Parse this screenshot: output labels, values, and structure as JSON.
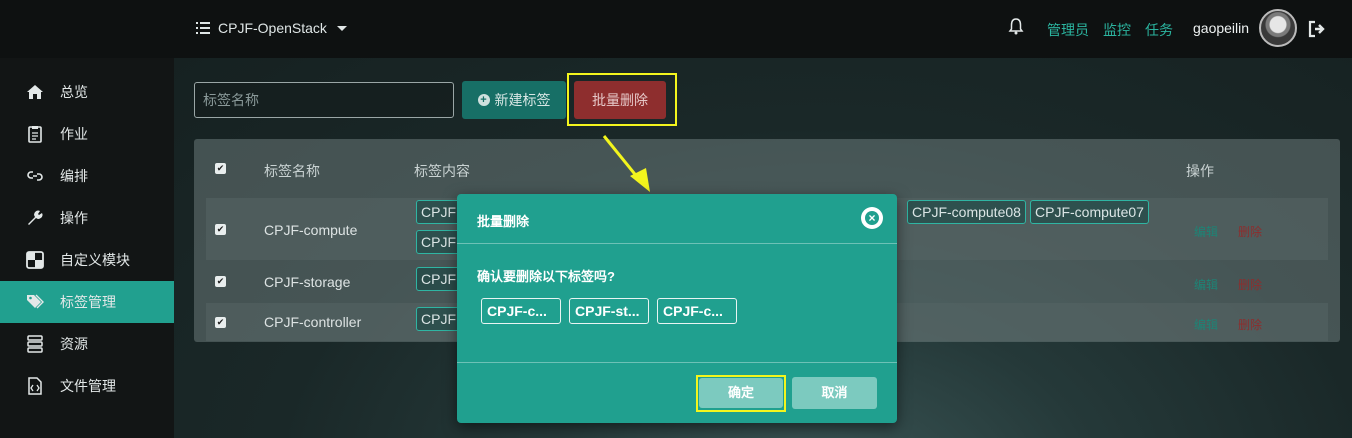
{
  "topbar": {
    "project": "CPJF-OpenStack",
    "links": [
      "管理员",
      "监控",
      "任务"
    ],
    "username": "gaopeilin"
  },
  "sidebar": {
    "items": [
      {
        "label": "总览",
        "icon": "home-icon"
      },
      {
        "label": "作业",
        "icon": "clipboard-icon"
      },
      {
        "label": "编排",
        "icon": "link-icon"
      },
      {
        "label": "操作",
        "icon": "wrench-icon"
      },
      {
        "label": "自定义模块",
        "icon": "grid-icon"
      },
      {
        "label": "标签管理",
        "icon": "tags-icon",
        "active": true
      },
      {
        "label": "资源",
        "icon": "server-icon"
      },
      {
        "label": "文件管理",
        "icon": "file-code-icon"
      }
    ]
  },
  "toolbar": {
    "search_placeholder": "标签名称",
    "new_label": "新建标签",
    "batch_delete_label": "批量删除"
  },
  "table": {
    "headers": {
      "name": "标签名称",
      "content": "标签内容",
      "actions": "操作"
    },
    "rows": [
      {
        "name": "CPJF-compute",
        "tags": [
          "CPJF",
          "CPJF-compute08",
          "CPJF-compute07",
          "CPJF"
        ],
        "edit": "编辑",
        "delete": "删除"
      },
      {
        "name": "CPJF-storage",
        "tags": [
          "CPJF"
        ],
        "edit": "编辑",
        "delete": "删除"
      },
      {
        "name": "CPJF-controller",
        "tags": [
          "CPJF"
        ],
        "edit": "编辑",
        "delete": "删除"
      }
    ]
  },
  "modal": {
    "title": "批量删除",
    "question": "确认要删除以下标签吗?",
    "tags": [
      "CPJF-c...",
      "CPJF-st...",
      "CPJF-c..."
    ],
    "ok_label": "确定",
    "cancel_label": "取消"
  },
  "colors": {
    "accent": "#21a08f",
    "danger": "#8e2e2e",
    "highlight": "#f3f51d"
  }
}
